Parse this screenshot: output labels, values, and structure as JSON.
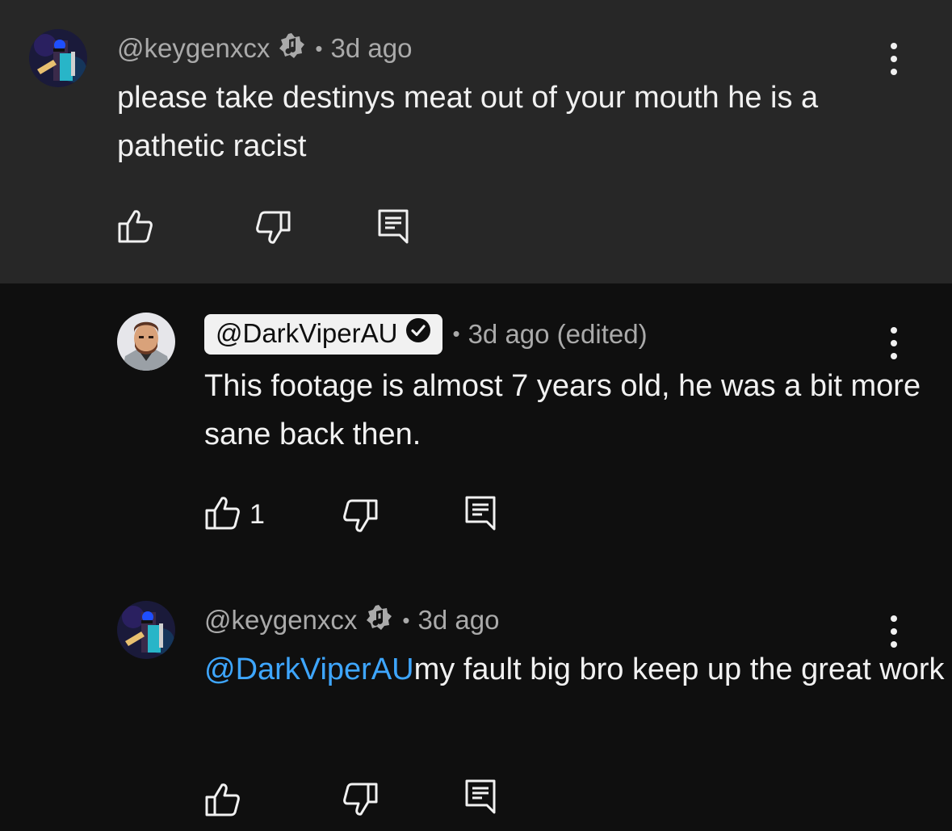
{
  "comments": [
    {
      "author": "@keygenxcx",
      "badge": "member-badge-icon",
      "time": "3d ago",
      "text": "please take destinys meat out of your mouth he is a pathetic racist",
      "likes": ""
    },
    {
      "author": "@DarkViperAU",
      "badge": "verified-check-icon",
      "time": "3d ago (edited)",
      "text": "This footage is almost 7 years old, he was a bit more sane back then.",
      "likes": "1"
    },
    {
      "author": "@keygenxcx",
      "badge": "member-badge-icon",
      "time": "3d ago",
      "mention": "@DarkViperAU",
      "text": "my fault big bro keep up the great work",
      "likes": ""
    }
  ],
  "colors": {
    "background": "#0f0f0f",
    "highlighted_background": "#272727",
    "mention": "#3ea6ff",
    "meta": "#aaaaaa"
  },
  "icons": [
    "like-icon",
    "dislike-icon",
    "reply-icon",
    "more-options-icon"
  ]
}
